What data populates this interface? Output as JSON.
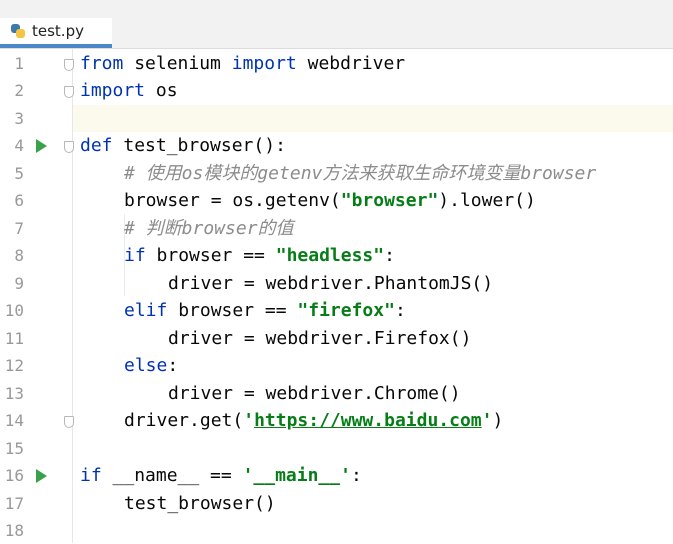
{
  "tab": {
    "filename": "test.py",
    "close_glyph": "×",
    "icon": "python-file-icon"
  },
  "lines": [
    {
      "num": "1"
    },
    {
      "num": "2"
    },
    {
      "num": "3"
    },
    {
      "num": "4"
    },
    {
      "num": "5"
    },
    {
      "num": "6"
    },
    {
      "num": "7"
    },
    {
      "num": "8"
    },
    {
      "num": "9"
    },
    {
      "num": "10"
    },
    {
      "num": "11"
    },
    {
      "num": "12"
    },
    {
      "num": "13"
    },
    {
      "num": "14"
    },
    {
      "num": "15"
    },
    {
      "num": "16"
    },
    {
      "num": "17"
    },
    {
      "num": "18"
    }
  ],
  "code": {
    "l1_kw1": "from",
    "l1_mod": " selenium ",
    "l1_kw2": "import",
    "l1_name": " webdriver",
    "l2_kw": "import",
    "l2_name": " os",
    "l4_kw": "def",
    "l4_rest": " test_browser():",
    "l5_comment": "# 使用os模块的getenv方法来获取生命环境变量browser",
    "l6_a": "browser = os.getenv(",
    "l6_str": "\"browser\"",
    "l6_b": ").lower()",
    "l7_comment": "# 判断browser的值",
    "l8_kw": "if",
    "l8_a": " browser == ",
    "l8_str": "\"headless\"",
    "l8_b": ":",
    "l9": "driver = webdriver.PhantomJS()",
    "l10_kw": "elif",
    "l10_a": " browser == ",
    "l10_str": "\"firefox\"",
    "l10_b": ":",
    "l11": "driver = webdriver.Firefox()",
    "l12_kw": "else",
    "l12_b": ":",
    "l13": "driver = webdriver.Chrome()",
    "l14_a": "driver.get(",
    "l14_q1": "'",
    "l14_url": "https://www.baidu.com",
    "l14_q2": "'",
    "l14_b": ")",
    "l16_kw": "if",
    "l16_a": " __name__ == ",
    "l16_str": "'__main__'",
    "l16_b": ":",
    "l17": "test_browser()"
  },
  "colors": {
    "keyword": "#0033b3",
    "string": "#067d17",
    "comment": "#8c8c8c",
    "run": "#3aa14b",
    "tab_accent": "#4a88c7"
  }
}
